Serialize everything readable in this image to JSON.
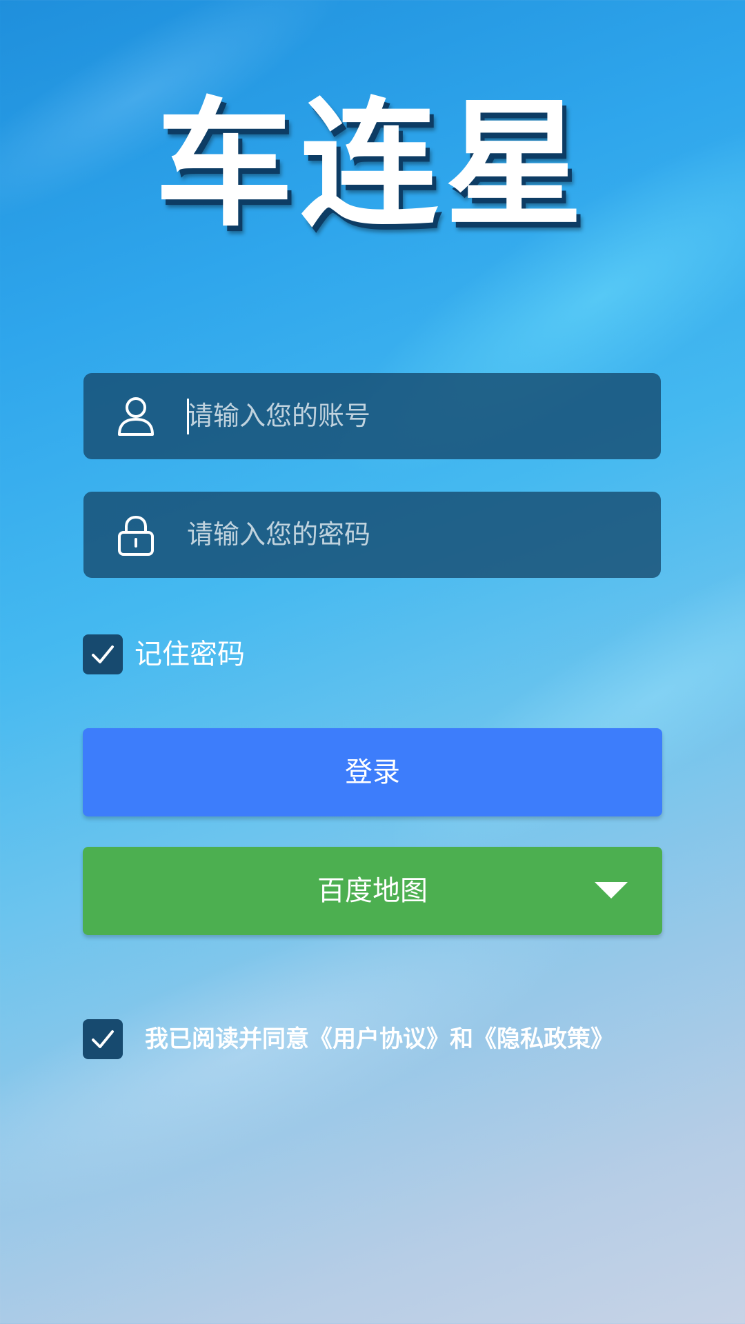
{
  "app": {
    "logo_text": "车连星"
  },
  "login_form": {
    "username_placeholder": "请输入您的账号",
    "password_placeholder": "请输入您的密码",
    "username_icon": "user-icon",
    "password_icon": "lock-icon",
    "remember_label": "记住密码",
    "remember_checked": true,
    "login_button": "登录",
    "map_select": {
      "selected": "百度地图",
      "icon": "chevron-down-icon"
    }
  },
  "agreement": {
    "checked": true,
    "prefix": "我已阅读并同意",
    "user_agreement": "《用户协议》",
    "conjunction": "和",
    "privacy_policy": "《隐私政策》"
  },
  "colors": {
    "login_button": "#3d7dfb",
    "map_button": "#4caf50",
    "input_bg": "#15486c",
    "checkbox_bg": "#174a6f"
  }
}
